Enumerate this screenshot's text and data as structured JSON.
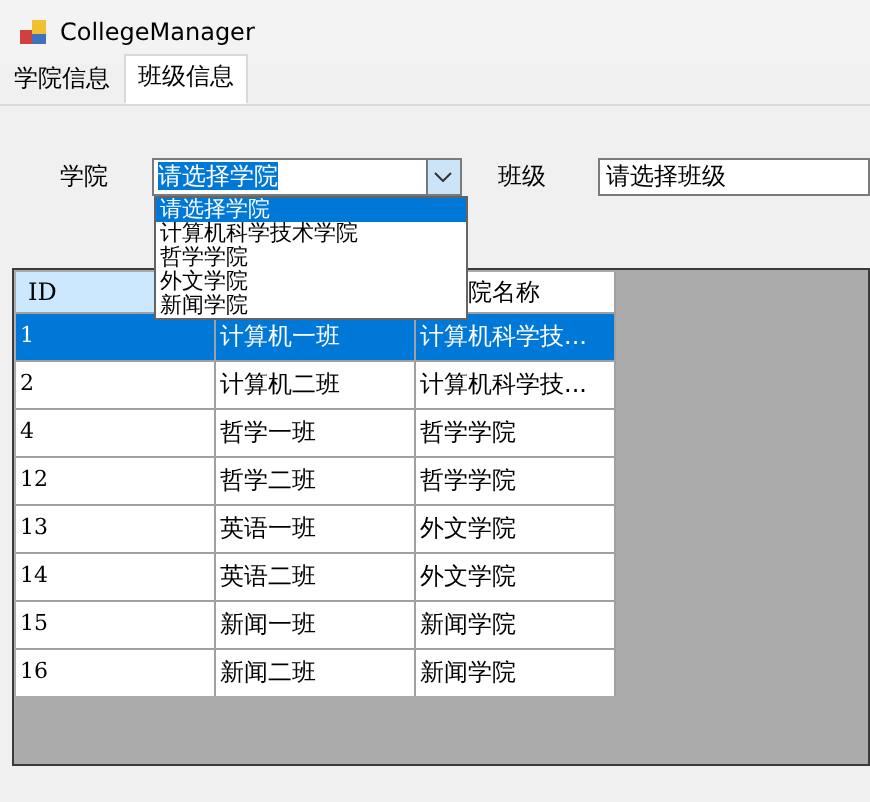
{
  "window": {
    "title": "CollegeManager"
  },
  "tabs": [
    {
      "label": "学院信息",
      "selected": false
    },
    {
      "label": "班级信息",
      "selected": true
    }
  ],
  "college_label": "学院",
  "college_combo": {
    "value": "请选择学院",
    "expanded": true,
    "options": [
      {
        "label": "请选择学院",
        "selected": true
      },
      {
        "label": "计算机科学技术学院",
        "selected": false
      },
      {
        "label": "哲学学院",
        "selected": false
      },
      {
        "label": "外文学院",
        "selected": false
      },
      {
        "label": "新闻学院",
        "selected": false
      }
    ]
  },
  "class_label": "班级",
  "class_combo": {
    "value": "请选择班级"
  },
  "table": {
    "columns": {
      "column_1": "ID",
      "column_3": "院名称"
    },
    "rows": [
      {
        "cells": [
          "1",
          "计算机一班",
          "计算机科学技..."
        ],
        "selected": true
      },
      {
        "cells": [
          "2",
          "计算机二班",
          "计算机科学技..."
        ],
        "selected": false
      },
      {
        "cells": [
          "4",
          "哲学一班",
          "哲学学院"
        ],
        "selected": false
      },
      {
        "cells": [
          "12",
          "哲学二班",
          "哲学学院"
        ],
        "selected": false
      },
      {
        "cells": [
          "13",
          "英语一班",
          "外文学院"
        ],
        "selected": false
      },
      {
        "cells": [
          "14",
          "英语二班",
          "外文学院"
        ],
        "selected": false
      },
      {
        "cells": [
          "15",
          "新闻一班",
          "新闻学院"
        ],
        "selected": false
      },
      {
        "cells": [
          "16",
          "新闻二班",
          "新闻学院"
        ],
        "selected": false
      }
    ]
  }
}
